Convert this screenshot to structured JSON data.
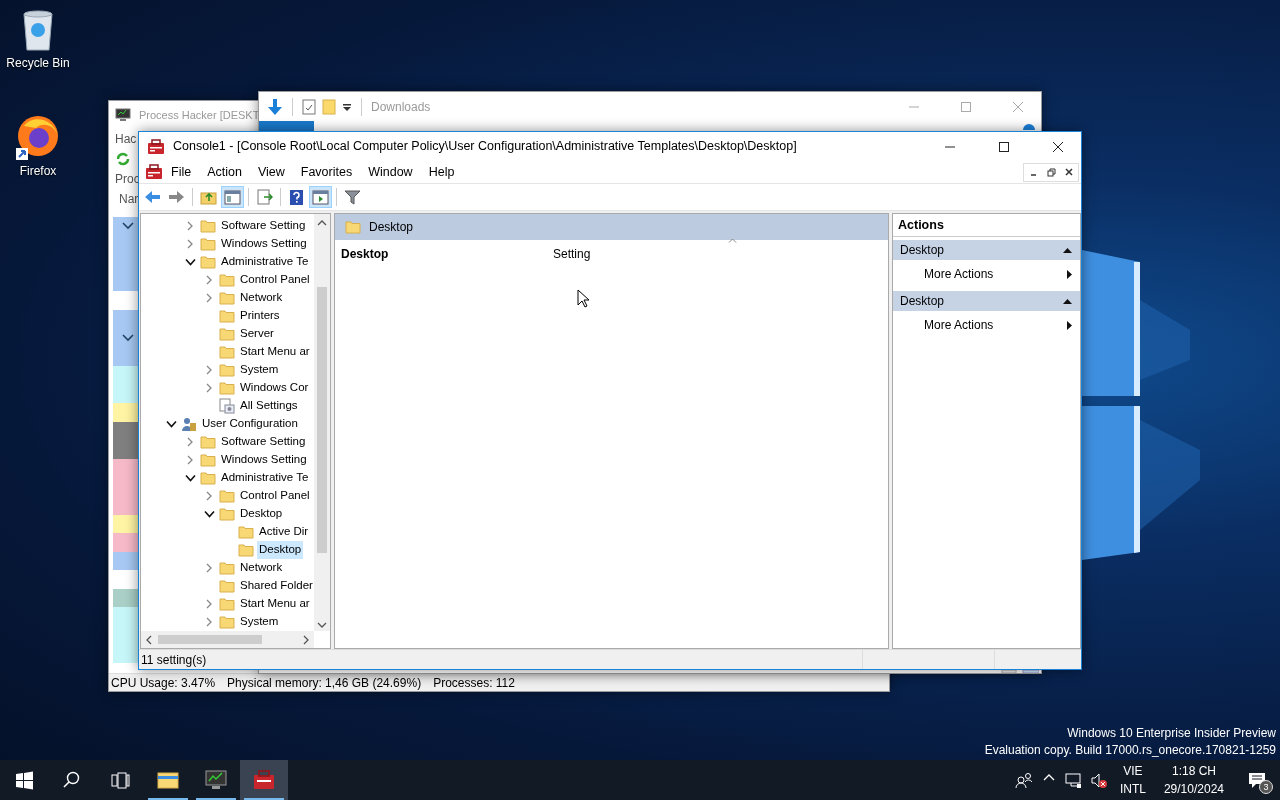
{
  "desktop_icons": [
    {
      "kind": "recycle-bin",
      "label": "Recycle Bin"
    },
    {
      "kind": "firefox",
      "label": "Firefox"
    }
  ],
  "process_hacker": {
    "title": "Process Hacker [DESKT",
    "menu": [
      "Hac"
    ],
    "tab": "Proc",
    "column": "Nar",
    "rows": [
      {
        "kind": "process",
        "color": "#a6c8f2",
        "expanded": true
      },
      {
        "kind": "process",
        "color": "#a6c8f2",
        "expanded": false
      },
      {
        "kind": "process",
        "color": "#a6c8f2",
        "expanded": false
      },
      {
        "kind": "process",
        "color": "#a6c8f2",
        "expanded": false
      },
      {
        "kind": "blank"
      },
      {
        "kind": "process",
        "color": "#a6c8f2",
        "expanded": false
      },
      {
        "kind": "process",
        "color": "#a6c8f2",
        "expanded": true
      },
      {
        "kind": "process",
        "color": "#a6c8f2",
        "expanded": false
      },
      {
        "kind": "process",
        "color": "#c7f6f8",
        "expanded": false
      },
      {
        "kind": "process",
        "color": "#c7f6f8",
        "expanded": false
      },
      {
        "kind": "process",
        "color": "#fff4a3",
        "expanded": false
      },
      {
        "kind": "process",
        "color": "#7f7f7f",
        "expanded": false
      },
      {
        "kind": "process",
        "color": "#7f7f7f",
        "expanded": false
      },
      {
        "kind": "process",
        "color": "#f6b9c7",
        "expanded": false
      },
      {
        "kind": "process",
        "color": "#f6b9c7",
        "expanded": false
      },
      {
        "kind": "process",
        "color": "#f6b9c7",
        "expanded": false
      },
      {
        "kind": "process",
        "color": "#fff4a3",
        "expanded": false
      },
      {
        "kind": "process",
        "color": "#f6b9c7",
        "expanded": false
      },
      {
        "kind": "process",
        "color": "#a6c8f2",
        "expanded": false
      },
      {
        "kind": "blank"
      },
      {
        "kind": "process",
        "color": "#a9cfc6",
        "expanded": false
      },
      {
        "kind": "process",
        "color": "#c7f6f8",
        "expanded": false
      },
      {
        "kind": "process",
        "color": "#c7f6f8",
        "expanded": false
      },
      {
        "kind": "process",
        "color": "#c7f6f8",
        "expanded": false
      }
    ],
    "status": [
      "CPU Usage: 3.47%",
      "Physical memory: 1,46 GB (24.69%)",
      "Processes: 112"
    ]
  },
  "downloads": {
    "title": "Downloads"
  },
  "console": {
    "title": "Console1 - [Console Root\\Local Computer Policy\\User Configuration\\Administrative Templates\\Desktop\\Desktop]",
    "menu": [
      "File",
      "Action",
      "View",
      "Favorites",
      "Window",
      "Help"
    ],
    "toolbar": [
      {
        "kind": "back",
        "pressed": false
      },
      {
        "kind": "forward",
        "pressed": false
      },
      {
        "kind": "separator"
      },
      {
        "kind": "up",
        "pressed": false
      },
      {
        "kind": "tree",
        "pressed": true
      },
      {
        "kind": "separator"
      },
      {
        "kind": "export",
        "pressed": false
      },
      {
        "kind": "separator"
      },
      {
        "kind": "help",
        "pressed": false
      },
      {
        "kind": "action-pane",
        "pressed": true
      },
      {
        "kind": "separator"
      },
      {
        "kind": "filter",
        "pressed": false
      }
    ],
    "tree": [
      {
        "children": [
          {
            "label": "Software Setting",
            "kind": "folder",
            "expanded": false,
            "selected": false
          },
          {
            "label": "Windows Setting",
            "kind": "folder",
            "expanded": false,
            "selected": false
          },
          {
            "label": "Administrative Te",
            "kind": "folder",
            "expanded": true,
            "selected": false,
            "children": [
              {
                "label": "Control Panel",
                "kind": "folder",
                "expanded": false,
                "selected": false
              },
              {
                "label": "Network",
                "kind": "folder",
                "expanded": false,
                "selected": false
              },
              {
                "label": "Printers",
                "kind": "folder",
                "selected": false
              },
              {
                "label": "Server",
                "kind": "folder",
                "selected": false
              },
              {
                "label": "Start Menu ar",
                "kind": "folder",
                "selected": false
              },
              {
                "label": "System",
                "kind": "folder",
                "expanded": false,
                "selected": false
              },
              {
                "label": "Windows Cor",
                "kind": "folder",
                "expanded": false,
                "selected": false
              },
              {
                "label": "All Settings",
                "kind": "settings",
                "selected": false
              }
            ]
          }
        ]
      },
      {
        "label": "User Configuration",
        "kind": "user",
        "expanded": true,
        "selected": false,
        "children": [
          {
            "label": "Software Setting",
            "kind": "folder",
            "expanded": false,
            "selected": false
          },
          {
            "label": "Windows Setting",
            "kind": "folder",
            "expanded": false,
            "selected": false
          },
          {
            "label": "Administrative Te",
            "kind": "folder",
            "expanded": true,
            "selected": false,
            "children": [
              {
                "label": "Control Panel",
                "kind": "folder",
                "expanded": false,
                "selected": false
              },
              {
                "label": "Desktop",
                "kind": "folder",
                "expanded": true,
                "selected": false,
                "children": [
                  {
                    "label": "Active Dir",
                    "kind": "folder",
                    "selected": false
                  },
                  {
                    "label": "Desktop",
                    "kind": "folder",
                    "selected": true
                  }
                ]
              },
              {
                "label": "Network",
                "kind": "folder",
                "expanded": false,
                "selected": false
              },
              {
                "label": "Shared Folder",
                "kind": "folder",
                "selected": false
              },
              {
                "label": "Start Menu ar",
                "kind": "folder",
                "expanded": false,
                "selected": false
              },
              {
                "label": "System",
                "kind": "folder",
                "expanded": false,
                "selected": false
              }
            ]
          }
        ]
      }
    ],
    "result": {
      "header": "Desktop",
      "name": "Desktop",
      "column": "Setting"
    },
    "actions": {
      "title": "Actions",
      "sections": [
        {
          "title": "Desktop",
          "items": [
            "More Actions"
          ]
        },
        {
          "title": "Desktop",
          "items": [
            "More Actions"
          ]
        }
      ]
    },
    "status": "11 setting(s)"
  },
  "os_notice": [
    "Windows 10 Enterprise Insider Preview",
    "Evaluation copy. Build 17000.rs_onecore.170821-1259"
  ],
  "taskbar": {
    "apps": [
      {
        "kind": "file-explorer",
        "running": true,
        "active": false
      },
      {
        "kind": "process-hacker",
        "running": true,
        "active": false
      },
      {
        "kind": "console",
        "running": true,
        "active": true
      }
    ],
    "language": "VIE",
    "layout": "INTL",
    "time": "1:18 CH",
    "date": "29/10/2024",
    "notifications": "3"
  }
}
